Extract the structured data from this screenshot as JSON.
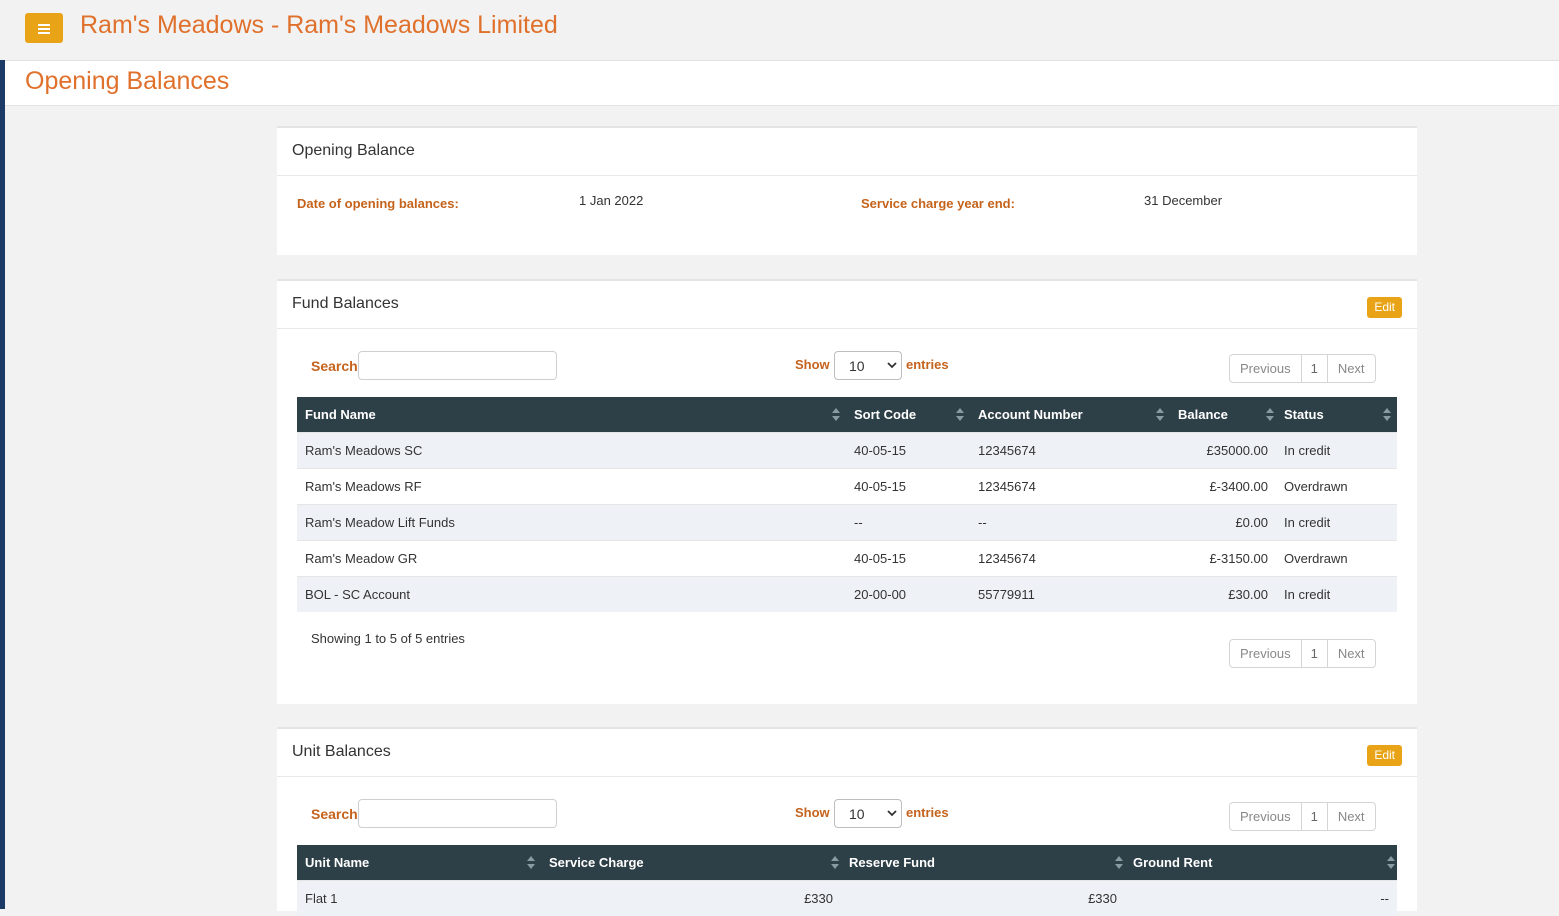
{
  "app": {
    "title": "Ram's Meadows - Ram's Meadows Limited"
  },
  "page": {
    "title": "Opening Balances"
  },
  "opening_balance": {
    "title": "Opening Balance",
    "date_label": "Date of opening balances:",
    "date_value": "1 Jan 2022",
    "year_end_label": "Service charge year end:",
    "year_end_value": "31 December"
  },
  "fund_balances": {
    "title": "Fund Balances",
    "edit_label": "Edit",
    "search_label": "Search",
    "show_label": "Show",
    "entries_value": "10",
    "entries_label": "entries",
    "pager": {
      "prev": "Previous",
      "page": "1",
      "next": "Next"
    },
    "columns": [
      "Fund Name",
      "Sort Code",
      "Account Number",
      "Balance",
      "Status"
    ],
    "rows": [
      {
        "name": "Ram's Meadows SC",
        "sort": "40-05-15",
        "account": "12345674",
        "balance": "£35000.00",
        "status": "In credit",
        "negative": false
      },
      {
        "name": "Ram's Meadows RF",
        "sort": "40-05-15",
        "account": "12345674",
        "balance": "£-3400.00",
        "status": "Overdrawn",
        "negative": true
      },
      {
        "name": "Ram's Meadow Lift Funds",
        "sort": "--",
        "account": "--",
        "balance": "£0.00",
        "status": "In credit",
        "negative": false
      },
      {
        "name": "Ram's Meadow GR",
        "sort": "40-05-15",
        "account": "12345674",
        "balance": "£-3150.00",
        "status": "Overdrawn",
        "negative": true
      },
      {
        "name": "BOL - SC Account",
        "sort": "20-00-00",
        "account": "55779911",
        "balance": "£30.00",
        "status": "In credit",
        "negative": false
      }
    ],
    "info": "Showing 1 to 5 of 5 entries"
  },
  "unit_balances": {
    "title": "Unit Balances",
    "edit_label": "Edit",
    "search_label": "Search",
    "show_label": "Show",
    "entries_value": "10",
    "entries_label": "entries",
    "pager": {
      "prev": "Previous",
      "page": "1",
      "next": "Next"
    },
    "columns": [
      "Unit Name",
      "Service Charge",
      "Reserve Fund",
      "Ground Rent"
    ],
    "rows": [
      {
        "name": "Flat 1",
        "service": "£330",
        "reserve": "£330",
        "ground": "--"
      }
    ]
  },
  "colors": {
    "accent": "#e0712c",
    "button": "#e8a317",
    "table_header": "#2d3f47",
    "negative": "#a0304a"
  }
}
